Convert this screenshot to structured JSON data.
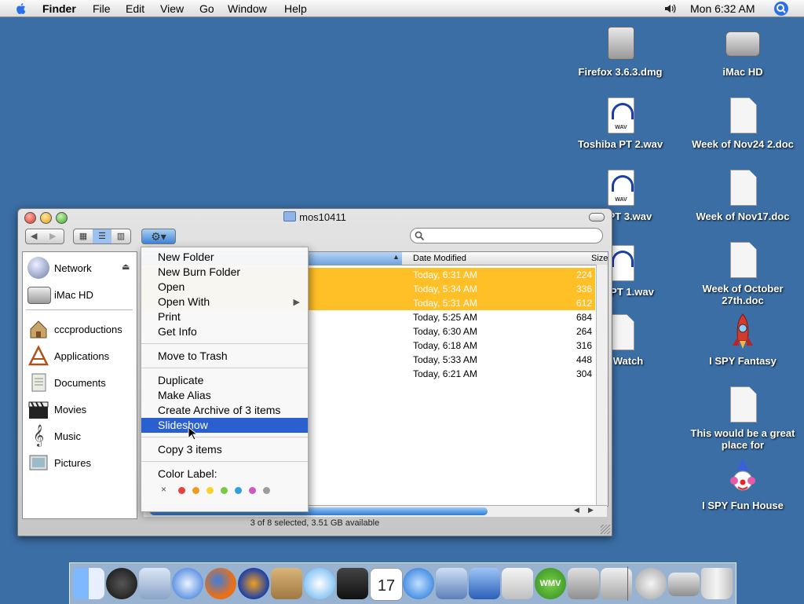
{
  "menubar": {
    "app": "Finder",
    "items": [
      "File",
      "Edit",
      "View",
      "Go",
      "Window",
      "Help"
    ],
    "clock": "Mon 6:32 AM"
  },
  "desktop": {
    "icons": [
      {
        "label": "Firefox 3.6.3.dmg",
        "icon": "dmg-icon"
      },
      {
        "label": "iMac HD",
        "icon": "hard-drive-icon"
      },
      {
        "label": "Toshiba PT 2.wav",
        "icon": "wav-audio-icon"
      },
      {
        "label": "Week of Nov24 2.doc",
        "icon": "document-icon"
      },
      {
        "label": "a PT 3.wav",
        "icon": "wav-audio-icon"
      },
      {
        "label": "Week of Nov17.doc",
        "icon": "document-icon"
      },
      {
        "label": "PT 1.wav",
        "icon": "wav-audio-icon"
      },
      {
        "label": "Week of October 27th.doc",
        "icon": "document-icon"
      },
      {
        "label": "Watch",
        "icon": "document-icon"
      },
      {
        "label": "I SPY Fantasy",
        "icon": "rocket-icon"
      },
      {
        "label": "This would be a great place for",
        "icon": "document-icon"
      },
      {
        "label": "I SPY Fun House",
        "icon": "clown-icon"
      }
    ],
    "wav_badge": "WAV"
  },
  "window": {
    "title": "mos10411",
    "status": "3 of 8 selected, 3.51 GB available",
    "sidebar": [
      {
        "label": "Network",
        "icon": "network-globe-icon"
      },
      {
        "label": "iMac HD",
        "icon": "hard-drive-icon"
      },
      {
        "label": "cccproductions",
        "icon": "home-icon"
      },
      {
        "label": "Applications",
        "icon": "applications-icon"
      },
      {
        "label": "Documents",
        "icon": "documents-icon"
      },
      {
        "label": "Movies",
        "icon": "movies-clapboard-icon"
      },
      {
        "label": "Music",
        "icon": "music-note-icon"
      },
      {
        "label": "Pictures",
        "icon": "pictures-icon"
      }
    ],
    "columns": {
      "date": "Date Modified",
      "size": "Size"
    },
    "rows": [
      {
        "date": "Today, 6:31 AM",
        "size": "224",
        "selected": true
      },
      {
        "date": "Today, 5:34 AM",
        "size": "336",
        "selected": true
      },
      {
        "date": "Today, 5:31 AM",
        "size": "612",
        "selected": true
      },
      {
        "date": "Today, 5:25 AM",
        "size": "684",
        "selected": false
      },
      {
        "date": "Today, 6:30 AM",
        "size": "264",
        "selected": false
      },
      {
        "date": "Today, 6:18 AM",
        "size": "316",
        "selected": false
      },
      {
        "date": "Today, 5:33 AM",
        "size": "448",
        "selected": false
      },
      {
        "date": "Today, 6:21 AM",
        "size": "304",
        "selected": false
      }
    ]
  },
  "context_menu": {
    "items": [
      "New Folder",
      "New Burn Folder",
      "Open",
      "Open With",
      "Print",
      "Get Info",
      "Move to Trash",
      "Duplicate",
      "Make Alias",
      "Create Archive of 3 items",
      "Slideshow",
      "Copy 3 items",
      "Color Label:"
    ],
    "highlighted": "Slideshow",
    "label_colors": [
      "#e8403a",
      "#f29a1f",
      "#f5d32b",
      "#7ac943",
      "#2f9fe0",
      "#c95bc2",
      "#9c9c9c"
    ]
  },
  "dock": {
    "apps": [
      "finder-icon",
      "dashboard-icon",
      "mail-icon",
      "safari-icon",
      "firefox-icon",
      "audacity-icon",
      "address-book-icon",
      "itunes-icon",
      "imovie-icon",
      "ical-icon",
      "quicktime-icon",
      "keynote-icon",
      "presentation-icon",
      "xcode-icon",
      "wmv-player-icon",
      "system-preferences-icon",
      "preview-icon"
    ],
    "right": [
      "network-icon",
      "hard-drive-icon",
      "trash-icon"
    ],
    "wmv_label": "WMV",
    "ical_day": "17"
  }
}
